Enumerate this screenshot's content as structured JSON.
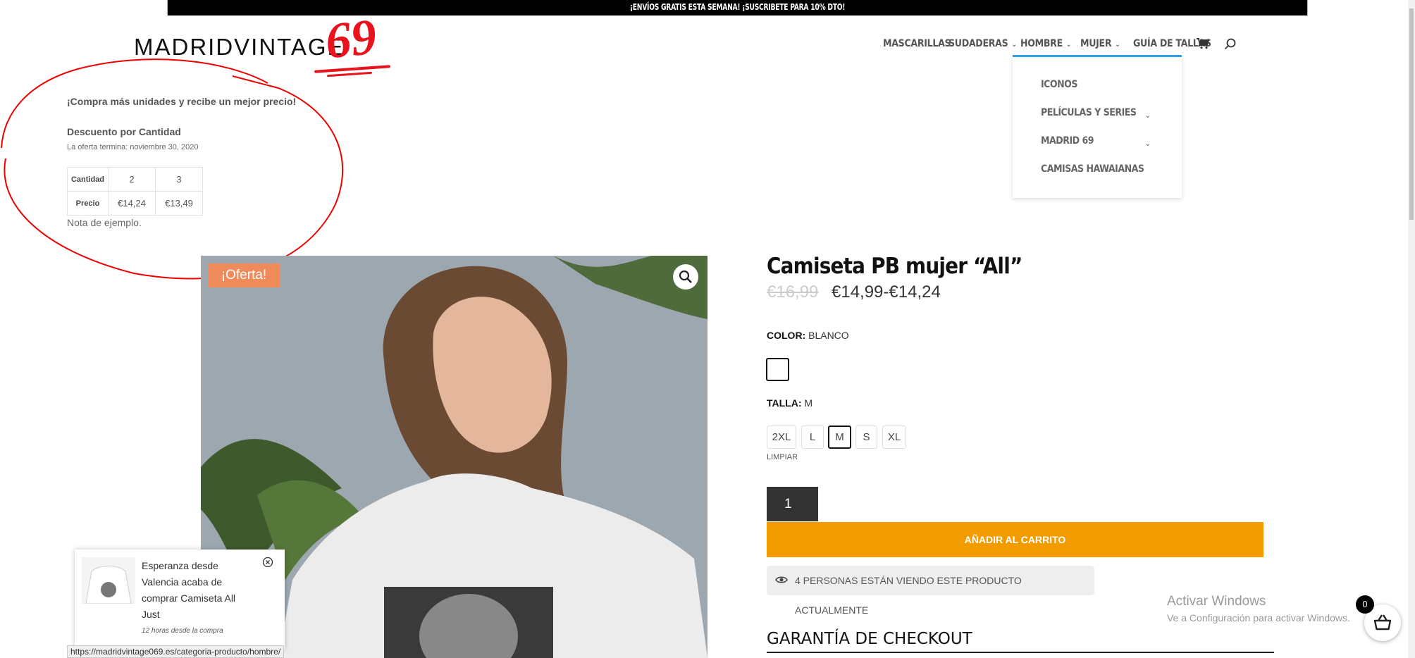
{
  "announcement": "¡ENVÍOS GRATIS ESTA SEMANA! ¡SUSCRIBETE PARA 10% DTO!",
  "logo": {
    "text": "MADRIDVINTAGE",
    "number": "69"
  },
  "nav": {
    "items": [
      {
        "label": "MASCARILLAS",
        "has_dropdown": false
      },
      {
        "label": "SUDADERAS",
        "has_dropdown": true
      },
      {
        "label": "HOMBRE",
        "has_dropdown": true,
        "active": true
      },
      {
        "label": "MUJER",
        "has_dropdown": true
      },
      {
        "label": "GUÍA DE TALLAS",
        "has_dropdown": false
      }
    ],
    "dropdown": [
      {
        "label": "ICONOS",
        "has_submenu": false
      },
      {
        "label": "PELÍCULAS Y SERIES",
        "has_submenu": true
      },
      {
        "label": "MADRID 69",
        "has_submenu": true
      },
      {
        "label": "CAMISAS HAWAIANAS",
        "has_submenu": false
      }
    ],
    "cart_icon": "cart-icon",
    "search_icon": "search-icon"
  },
  "bulk": {
    "promo": "¡Compra más unidades y recibe un mejor precio!",
    "title": "Descuento por Cantidad",
    "ends": "La oferta termina: noviembre 30, 2020",
    "table": {
      "qty_label": "Cantidad",
      "price_label": "Precio",
      "quantities": [
        "2",
        "3"
      ],
      "prices": [
        "€14,24",
        "€13,49"
      ]
    },
    "note": "Nota de ejemplo."
  },
  "product": {
    "sale_badge": "¡Oferta!",
    "title": "Camiseta PB mujer “All”",
    "old_price": "€16,99",
    "price_range": "€14,99-€14,24",
    "color_label": "COLOR:",
    "color_value": "BLANCO",
    "size_label": "TALLA:",
    "size_value": "M",
    "sizes": [
      "2XL",
      "L",
      "M",
      "S",
      "XL"
    ],
    "selected_size": "M",
    "clear": "LIMPIAR",
    "quantity": "1",
    "add_to_cart": "AÑADIR AL CARRITO",
    "viewers": "4 PERSONAS ESTÁN VIENDO ESTE PRODUCTO ACTUALMENTE",
    "guarantee": "GARANTÍA DE CHECKOUT"
  },
  "notification": {
    "text": "Esperanza desde Valencia acaba de comprar Camiseta All Just",
    "time": "12 horas desde la compra"
  },
  "windows": {
    "line1": "Activar Windows",
    "line2": "Ve a Configuración para activar Windows."
  },
  "cart_count": "0",
  "status_url": "https://madridvintage069.es/categoria-producto/hombre/",
  "colors": {
    "accent": "#f39c00",
    "sale": "#ef8a5a",
    "nav_active": "#2ea3f2",
    "logo_red": "#e8131d"
  }
}
